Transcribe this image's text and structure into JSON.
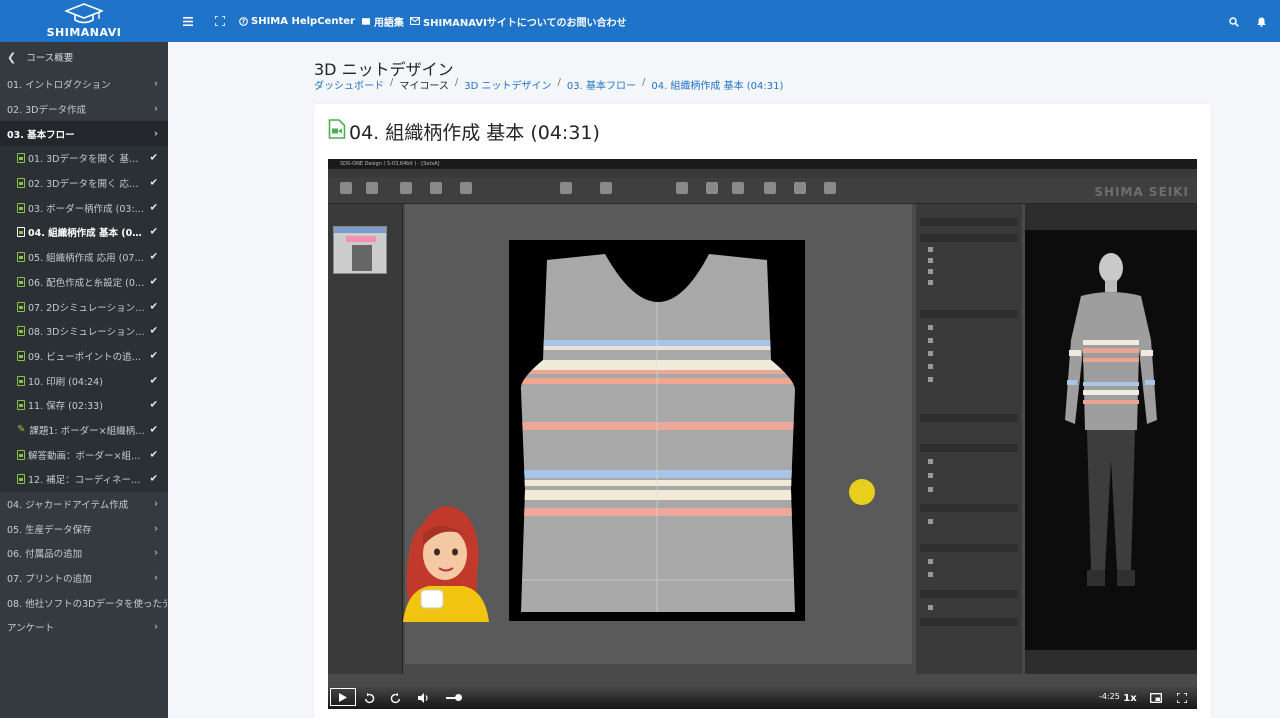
{
  "topbar": {
    "brand": "SHIMANAVI",
    "help_center": "SHIMA HelpCenter",
    "glossary": "用語集",
    "contact": "SHIMANAVIサイトについてのお問い合わせ"
  },
  "sidebar": {
    "header": "コース概要",
    "sections": [
      {
        "label": "01. イントロダクション"
      },
      {
        "label": "02. 3Dデータ作成"
      },
      {
        "label": "03. 基本フロー",
        "active": true
      }
    ],
    "lessons": [
      {
        "label": "01. 3Dデータを開く 基本 (...",
        "type": "video"
      },
      {
        "label": "02. 3Dデータを開く 応用 (...",
        "type": "video"
      },
      {
        "label": "03. ボーダー柄作成 (03:39)",
        "type": "video"
      },
      {
        "label": "04. 組織柄作成 基本 (04:31)",
        "type": "video",
        "current": true
      },
      {
        "label": "05. 組織柄作成 応用 (07:04)",
        "type": "video"
      },
      {
        "label": "06. 配色作成と糸設定 (05:...",
        "type": "video"
      },
      {
        "label": "07. 2Dシミュレーション実...",
        "type": "video"
      },
      {
        "label": "08. 3Dシミュレーション実...",
        "type": "video"
      },
      {
        "label": "09. ビューポイントの追加 ...",
        "type": "video"
      },
      {
        "label": "10. 印刷 (04:24)",
        "type": "video"
      },
      {
        "label": "11. 保存 (02:33)",
        "type": "video"
      },
      {
        "label": "課題1: ボーダー×組織柄プ...",
        "type": "task"
      },
      {
        "label": "解答動画：ボーダー×組織...",
        "type": "video"
      },
      {
        "label": "12. 補足：コーディネート...",
        "type": "video"
      }
    ],
    "sections_after": [
      {
        "label": "04. ジャカードアイテム作成"
      },
      {
        "label": "05. 生産データ保存"
      },
      {
        "label": "06. 付属品の追加"
      },
      {
        "label": "07. プリントの追加"
      },
      {
        "label": "08. 他社ソフトの3Dデータを使ったデザ"
      },
      {
        "label": "アンケート"
      }
    ]
  },
  "main": {
    "page_title": "3D ニットデザイン",
    "breadcrumb": [
      "ダッシュボード",
      "マイコース",
      "3D ニットデザイン",
      "03. 基本フロー",
      "04. 組織柄作成 基本 (04:31)"
    ],
    "lesson_title": "04. 組織柄作成 基本 (04:31)"
  },
  "video": {
    "app_title": "SDS-ONE Design ( S-03,64bit ) - [SetsA]",
    "app_brand": "SHIMA SEIKI",
    "time_remaining": "-4:25",
    "speed": "1x",
    "progress": 0.1
  },
  "colors": {
    "topbar": "#1f73c9",
    "sidebar": "#343a40",
    "check": "#8bc34a"
  }
}
